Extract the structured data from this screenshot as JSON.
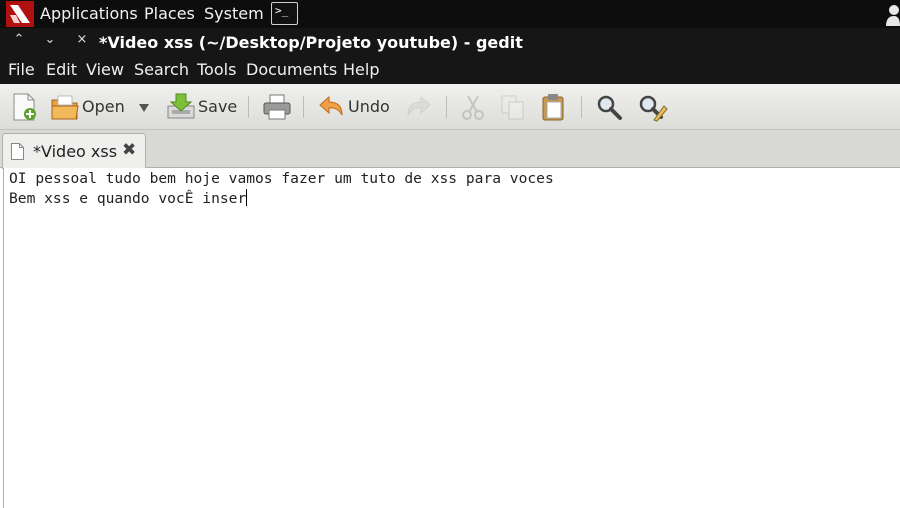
{
  "panel": {
    "menus": [
      "Applications",
      "Places",
      "System"
    ],
    "terminal_icon": "terminal-icon",
    "logo_icon": "distro-logo-icon",
    "user_icon": "user-icon"
  },
  "window": {
    "title": "*Video xss (~/Desktop/Projeto youtube) - gedit",
    "buttons": [
      "^",
      "v",
      "×"
    ]
  },
  "menubar": [
    "File",
    "Edit",
    "View",
    "Search",
    "Tools",
    "Documents",
    "Help"
  ],
  "toolbar": {
    "open_label": "Open",
    "save_label": "Save",
    "undo_label": "Undo"
  },
  "tab": {
    "label": "*Video xss",
    "close": "✖"
  },
  "editor": {
    "lines": [
      "OI pessoal tudo bem hoje vamos fazer um tuto de xss para voces",
      "Bem xss e quando vocÊ inser"
    ]
  }
}
